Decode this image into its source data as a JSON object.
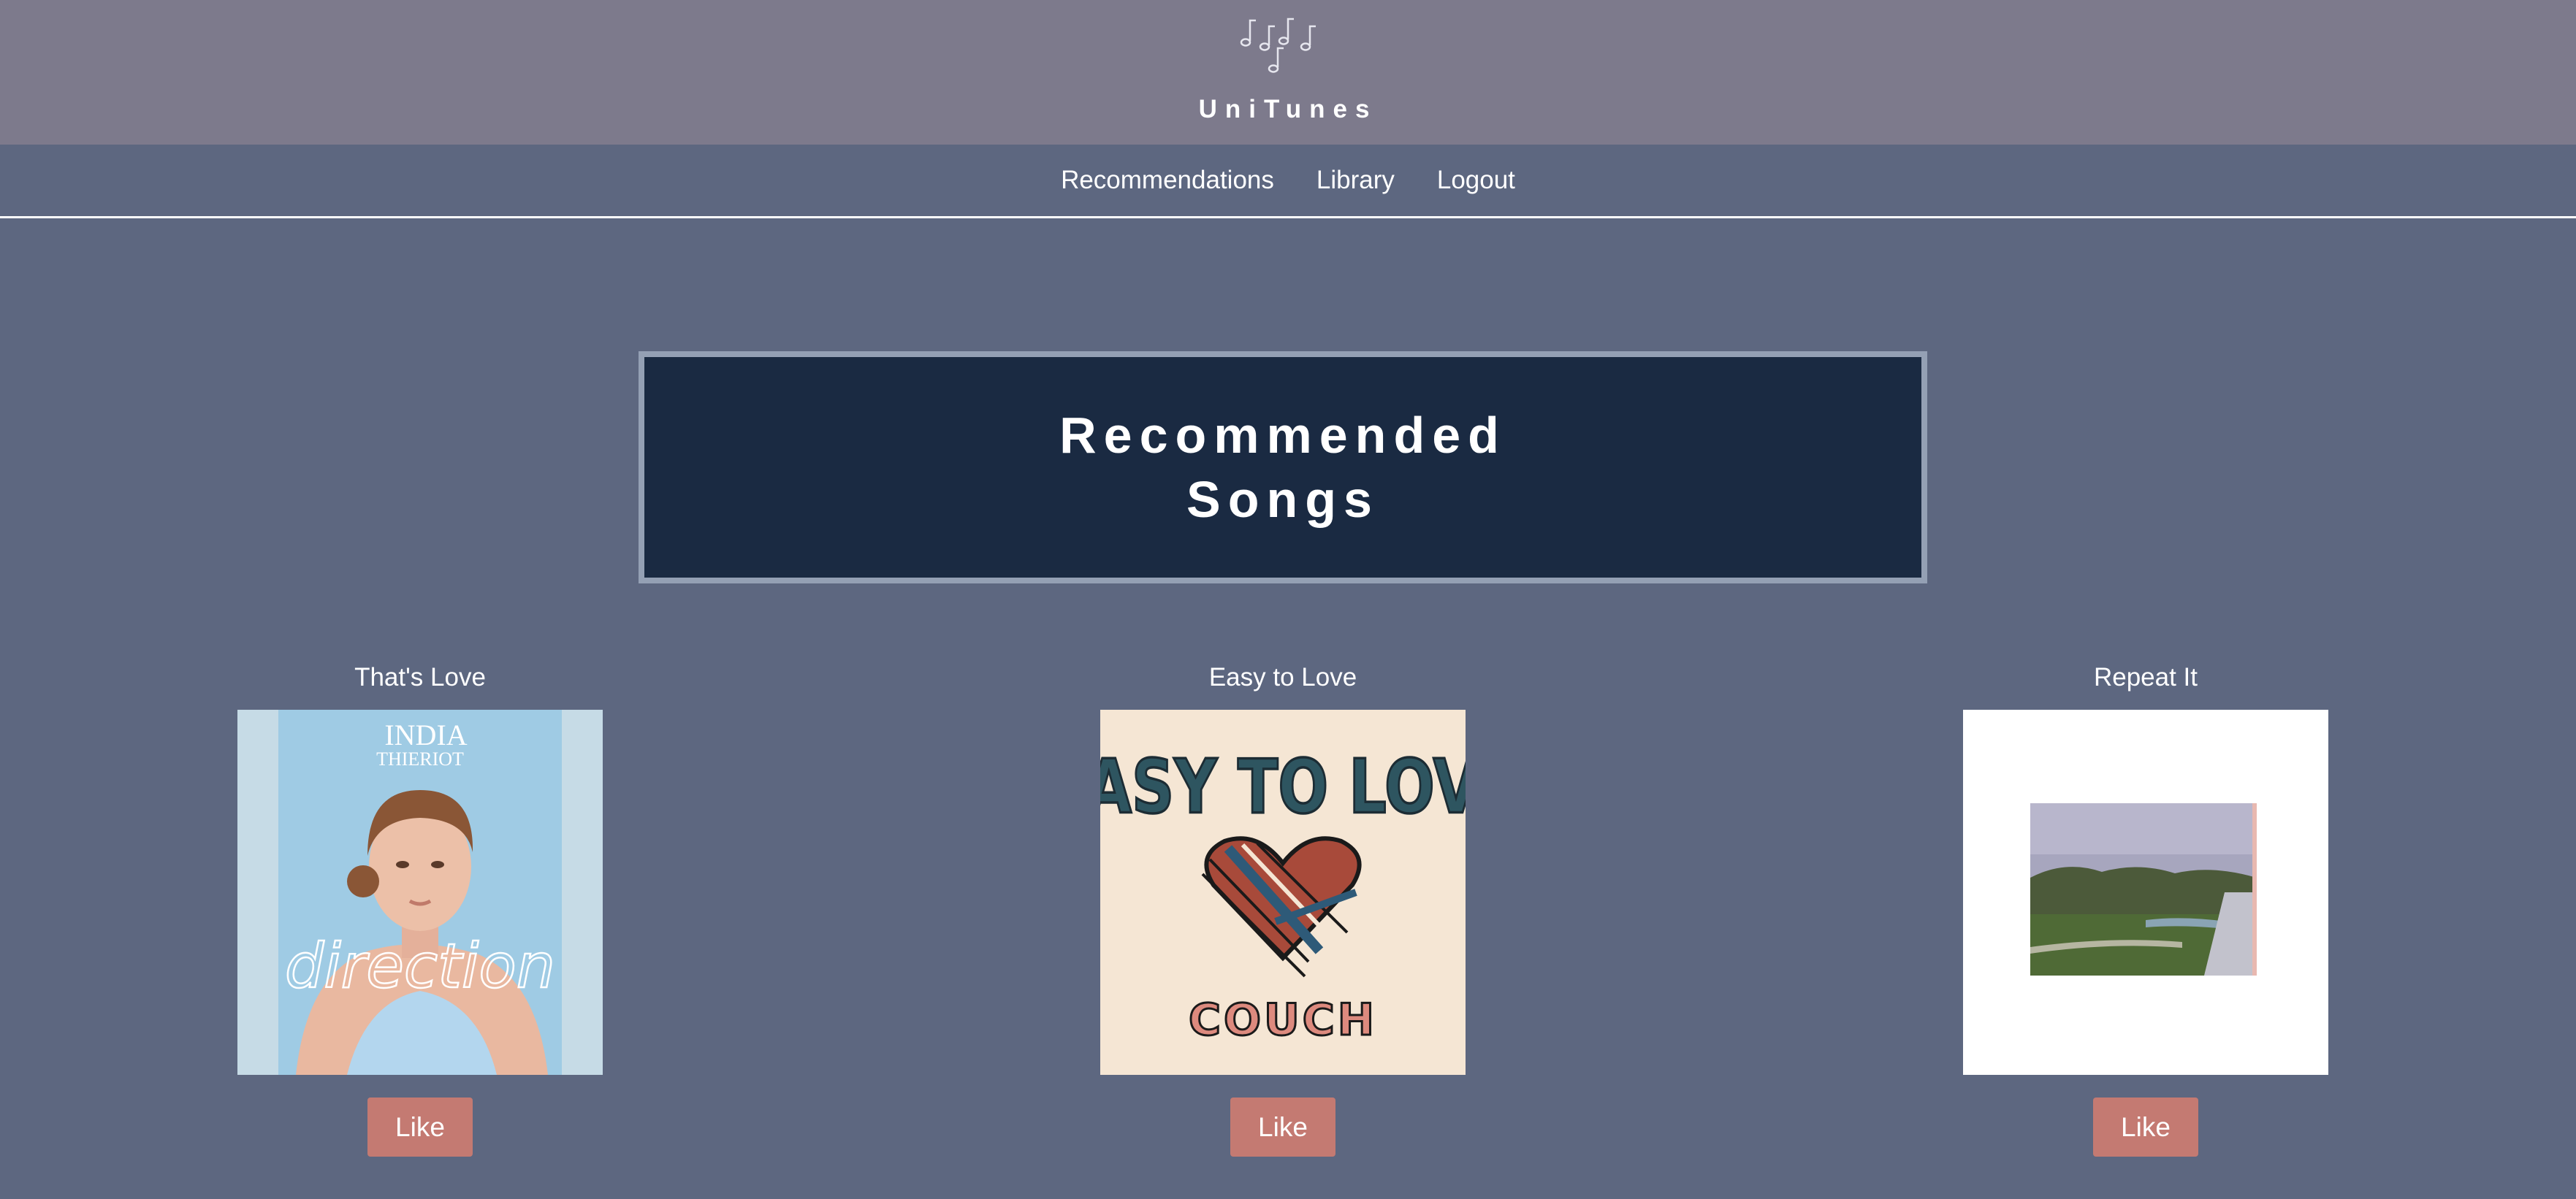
{
  "header": {
    "app_name": "UniTunes",
    "logo_icon": "music-notes-icon"
  },
  "nav": {
    "items": [
      {
        "label": "Recommendations"
      },
      {
        "label": "Library"
      },
      {
        "label": "Logout"
      }
    ]
  },
  "hero": {
    "title_line1": "Recommended",
    "title_line2": "Songs"
  },
  "songs": [
    {
      "title": "That's Love",
      "cover_text_artist_1": "INDIA",
      "cover_text_artist_2": "THIERIOT",
      "cover_text_album": "direction",
      "like_label": "Like"
    },
    {
      "title": "Easy to Love",
      "cover_text_top": "EASY TO LOVE",
      "cover_text_bottom": "COUCH",
      "like_label": "Like"
    },
    {
      "title": "Repeat It",
      "like_label": "Like"
    }
  ],
  "colors": {
    "header_bg": "#7d7a8c",
    "page_bg": "#5d6780",
    "hero_bg": "#1a2a42",
    "hero_border": "#94a0b4",
    "like_button": "#c47a72"
  }
}
